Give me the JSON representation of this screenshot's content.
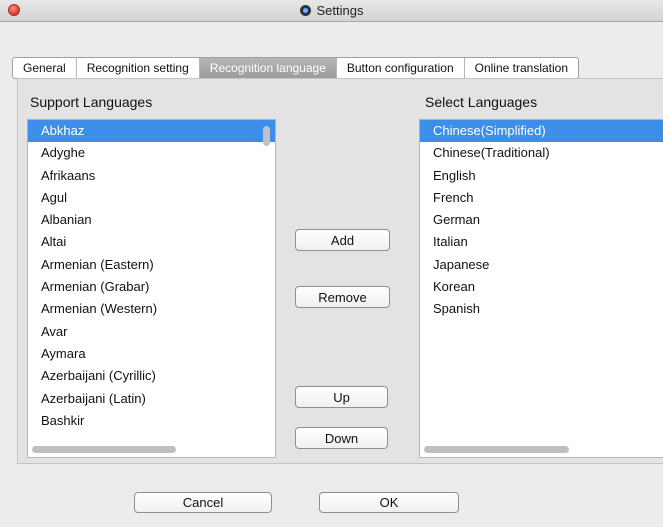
{
  "window": {
    "title": "Settings"
  },
  "tabs": [
    {
      "label": "General",
      "active": false
    },
    {
      "label": "Recognition setting",
      "active": false
    },
    {
      "label": "Recognition language",
      "active": true
    },
    {
      "label": "Button configuration",
      "active": false
    },
    {
      "label": "Online translation",
      "active": false
    }
  ],
  "support": {
    "label": "Support Languages",
    "items": [
      "Abkhaz",
      "Adyghe",
      "Afrikaans",
      "Agul",
      "Albanian",
      "Altai",
      "Armenian (Eastern)",
      "Armenian (Grabar)",
      "Armenian (Western)",
      "Avar",
      "Aymara",
      "Azerbaijani (Cyrillic)",
      "Azerbaijani (Latin)",
      "Bashkir"
    ],
    "selected_index": 0
  },
  "selected": {
    "label": "Select Languages",
    "items": [
      "Chinese(Simplified)",
      "Chinese(Traditional)",
      "English",
      "French",
      "German",
      "Italian",
      "Japanese",
      "Korean",
      "Spanish"
    ],
    "selected_index": 0
  },
  "buttons": {
    "add": "Add",
    "remove": "Remove",
    "up": "Up",
    "down": "Down",
    "cancel": "Cancel",
    "ok": "OK"
  },
  "colors": {
    "selection": "#3d8ee8",
    "active_tab": "#a9a9a9"
  }
}
